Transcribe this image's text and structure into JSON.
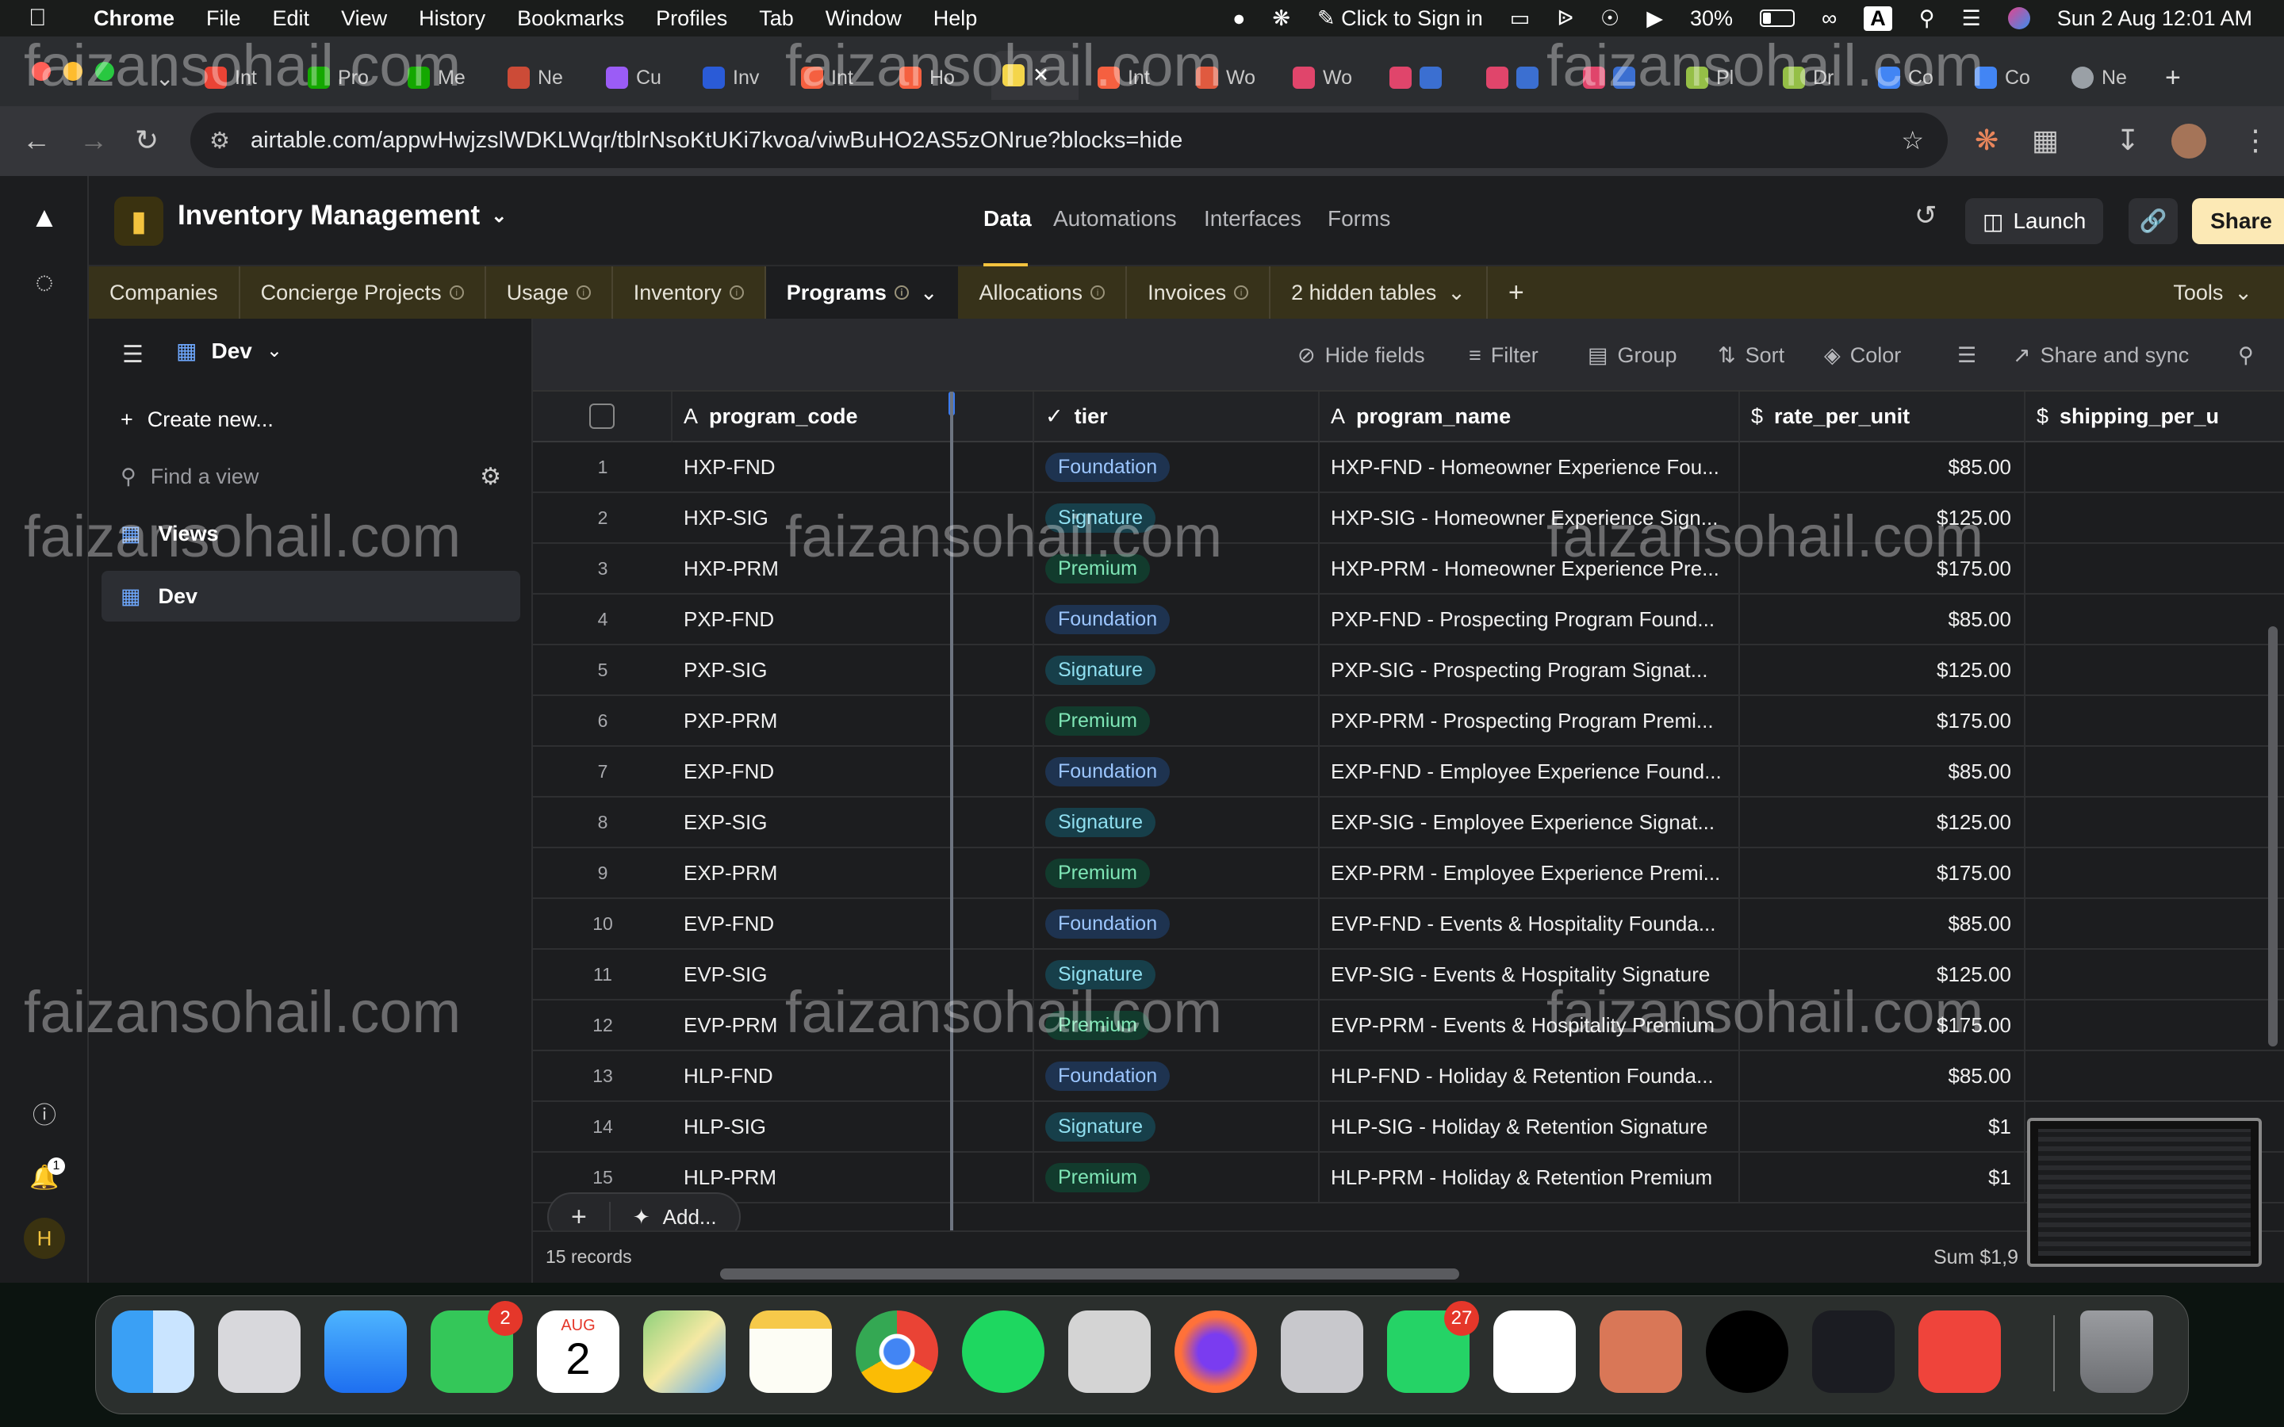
{
  "menubar": {
    "app": "Chrome",
    "items": [
      "File",
      "Edit",
      "View",
      "History",
      "Bookmarks",
      "Profiles",
      "Tab",
      "Window",
      "Help"
    ],
    "sign_in": "Click to Sign in",
    "battery": "30%",
    "input": "A",
    "datetime": "Sun 2 Aug  12:01 AM"
  },
  "browser": {
    "tabs": [
      "Int",
      "Pro",
      "Me",
      "Ne",
      "Cu",
      "Inv",
      "Int",
      "Ho",
      "",
      "Int",
      "Wo",
      "Wo",
      "",
      "",
      "",
      "Pl",
      "Dr",
      "Co",
      "Co",
      "Ne"
    ],
    "url": "airtable.com/appwHwjzslWDKLWqr/tblrNsoKtUKi7kvoa/viwBuHO2AS5zONrue?blocks=hide"
  },
  "airtable": {
    "base_name": "Inventory Management",
    "nav": {
      "data": "Data",
      "automations": "Automations",
      "interfaces": "Interfaces",
      "forms": "Forms"
    },
    "launch": "Launch",
    "share": "Share",
    "tables": [
      "Companies",
      "Concierge Projects",
      "Usage",
      "Inventory",
      "Programs",
      "Allocations",
      "Invoices"
    ],
    "hidden_tables": "2 hidden tables",
    "tools": "Tools",
    "view_name": "Dev",
    "sidebar": {
      "create_new": "Create new...",
      "find_placeholder": "Find a view",
      "views_label": "Views",
      "dev": "Dev"
    },
    "toolbar": {
      "hide_fields": "Hide fields",
      "filter": "Filter",
      "group": "Group",
      "sort": "Sort",
      "color": "Color",
      "share_sync": "Share and sync"
    },
    "columns": {
      "program_code": "program_code",
      "tier": "tier",
      "program_name": "program_name",
      "rate_per_unit": "rate_per_unit",
      "shipping": "shipping_per_u"
    },
    "records_count": "15 records",
    "sum_label": "Sum $1,9",
    "add_label": "Add...",
    "rows": [
      {
        "n": "1",
        "code": "HXP-FND",
        "tier": "Foundation",
        "name": "HXP-FND - Homeowner Experience Fou...",
        "rate": "$85.00"
      },
      {
        "n": "2",
        "code": "HXP-SIG",
        "tier": "Signature",
        "name": "HXP-SIG - Homeowner Experience Sign...",
        "rate": "$125.00"
      },
      {
        "n": "3",
        "code": "HXP-PRM",
        "tier": "Premium",
        "name": "HXP-PRM - Homeowner Experience Pre...",
        "rate": "$175.00"
      },
      {
        "n": "4",
        "code": "PXP-FND",
        "tier": "Foundation",
        "name": "PXP-FND - Prospecting Program Found...",
        "rate": "$85.00"
      },
      {
        "n": "5",
        "code": "PXP-SIG",
        "tier": "Signature",
        "name": "PXP-SIG - Prospecting Program Signat...",
        "rate": "$125.00"
      },
      {
        "n": "6",
        "code": "PXP-PRM",
        "tier": "Premium",
        "name": "PXP-PRM - Prospecting Program Premi...",
        "rate": "$175.00"
      },
      {
        "n": "7",
        "code": "EXP-FND",
        "tier": "Foundation",
        "name": "EXP-FND - Employee Experience Found...",
        "rate": "$85.00"
      },
      {
        "n": "8",
        "code": "EXP-SIG",
        "tier": "Signature",
        "name": "EXP-SIG - Employee Experience Signat...",
        "rate": "$125.00"
      },
      {
        "n": "9",
        "code": "EXP-PRM",
        "tier": "Premium",
        "name": "EXP-PRM - Employee Experience Premi...",
        "rate": "$175.00"
      },
      {
        "n": "10",
        "code": "EVP-FND",
        "tier": "Foundation",
        "name": "EVP-FND - Events & Hospitality Founda...",
        "rate": "$85.00"
      },
      {
        "n": "11",
        "code": "EVP-SIG",
        "tier": "Signature",
        "name": "EVP-SIG - Events & Hospitality Signature",
        "rate": "$125.00"
      },
      {
        "n": "12",
        "code": "EVP-PRM",
        "tier": "Premium",
        "name": "EVP-PRM - Events & Hospitality Premium",
        "rate": "$175.00"
      },
      {
        "n": "13",
        "code": "HLP-FND",
        "tier": "Foundation",
        "name": "HLP-FND - Holiday & Retention Founda...",
        "rate": "$85.00"
      },
      {
        "n": "14",
        "code": "HLP-SIG",
        "tier": "Signature",
        "name": "HLP-SIG - Holiday & Retention Signature",
        "rate": "$1"
      },
      {
        "n": "15",
        "code": "HLP-PRM",
        "tier": "Premium",
        "name": "HLP-PRM - Holiday & Retention Premium",
        "rate": "$1"
      }
    ]
  },
  "dock": {
    "messages_badge": "2",
    "calendar_month": "AUG",
    "calendar_day": "2",
    "whatsapp_badge": "27"
  },
  "left_rail": {
    "avatar": "H",
    "bell_badge": "1"
  },
  "watermark": "faizansohail.com"
}
